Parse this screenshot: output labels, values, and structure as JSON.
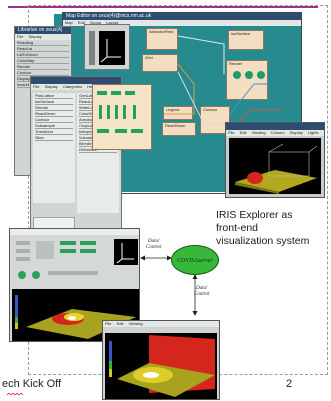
{
  "slide": {
    "caption_lines": [
      "IRIS Explorer as",
      "front-end",
      "visualization system"
    ],
    "footer_left": "ech Kick Off",
    "page_number": "2"
  },
  "editor_window": {
    "title": "Map Editor on zeus(4)@mcs.nm.ac.uk",
    "menu": [
      "Map",
      "Edit",
      "Group",
      "Layout"
    ]
  },
  "library_window": {
    "title": "Librarian on zeus(4)",
    "menu": [
      "File",
      "Display",
      "Categories",
      "Help"
    ],
    "left_list": [
      "ReadImg",
      "ReadLat",
      "LatToGeom",
      "ColorMap",
      "Render",
      "Contour",
      "Display",
      "Isosurf"
    ]
  },
  "category_window": {
    "menu": [
      "File",
      "Display",
      "Categories",
      "Help"
    ],
    "col1": [
      "PickLattice",
      "IsoSurface",
      "Render",
      "ReadGeom",
      "Contour",
      "Subsample",
      "Transform",
      "Slice"
    ],
    "col2": [
      "GenLat",
      "ReadLat",
      "WriteLat",
      "ColorMap",
      "Annotate",
      "CropLat",
      "Interpolate",
      "Volume",
      "BlendImg",
      "Orthoslice"
    ]
  },
  "map_modules": [
    {
      "label": "AdvectorField"
    },
    {
      "label": "Grid"
    },
    {
      "label": "IsoSurface"
    },
    {
      "label": "Render"
    },
    {
      "label": "Legend"
    },
    {
      "label": "ReadGeom"
    },
    {
      "label": "Contour"
    }
  ],
  "connector": {
    "center_label": "COVISAserver",
    "left_label_line1": "Data/",
    "left_label_line2": "Control",
    "bottom_label_line1": "Data/",
    "bottom_label_line2": "Control"
  },
  "render_menu": [
    "File",
    "Edit",
    "Viewing",
    "Colours",
    "Display",
    "Lights"
  ],
  "colors": {
    "teal": "#268a8f",
    "title_blue": "#2c4c70",
    "panel_gray": "#cfd6d4",
    "module_tan": "#f3dec1",
    "oval_green": "#37b83a",
    "surface_yellow": "#a9a21e",
    "surface_red": "#d4261c",
    "rule_magenta": "#a0308a"
  }
}
